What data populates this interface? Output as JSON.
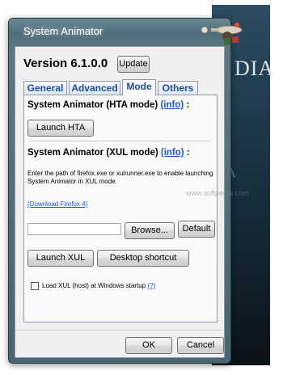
{
  "window": {
    "title": "System Animator"
  },
  "header": {
    "version": "Version 6.1.0.0",
    "update_label": "Update"
  },
  "tabs": [
    {
      "label": "General"
    },
    {
      "label": "Advanced"
    },
    {
      "label": "Mode"
    },
    {
      "label": "Others"
    }
  ],
  "active_tab": "Mode",
  "hta": {
    "heading": "System Animator (HTA mode)",
    "info_link": "(info)",
    "colon": ":",
    "launch_label": "Launch HTA"
  },
  "xul": {
    "heading": "System Animator (XUL mode)",
    "info_link": "(info)",
    "colon": ":",
    "description": "Enter the path of firefox.exe or xulrunner.exe to enable launching System Animator in XUL mode.",
    "download_link": "(Download Firefox 4)",
    "path_value": "",
    "browse_label": "Browse...",
    "default_label": "Default",
    "launch_label": "Launch XUL",
    "shortcut_label": "Desktop shortcut",
    "startup_label": "Load XUL (host) at Windows startup",
    "startup_help": "(?)",
    "startup_checked": false
  },
  "footer": {
    "ok_label": "OK",
    "cancel_label": "Cancel"
  },
  "background": {
    "wallpaper_text": "DIA",
    "wallpaper_text2": "ATA",
    "watermark": "www.softpedia.com"
  },
  "colors": {
    "link": "#1a56c9",
    "tab_text": "#1a4ea0",
    "frame": "#4f6e7b"
  }
}
